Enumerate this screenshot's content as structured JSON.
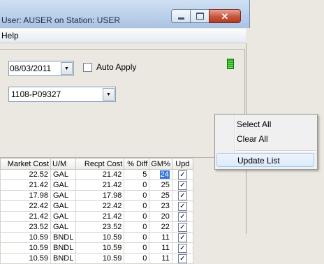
{
  "window": {
    "title": "User: AUSER on Station: USER",
    "close_glyph": "✕"
  },
  "menubar": {
    "items": [
      "Help"
    ]
  },
  "form": {
    "date_value": "08/03/2011",
    "auto_apply_label": "Auto Apply",
    "auto_apply_checked": false,
    "po_value": "1108-P09327",
    "status_color": "#2db31f"
  },
  "grid": {
    "columns": [
      "Market Cost",
      "U/M",
      "Recpt Cost",
      "% Diff",
      "GM%",
      "Upd"
    ],
    "rows": [
      {
        "market_cost": "22.52",
        "um": "GAL",
        "recpt_cost": "21.42",
        "pct_diff": "5",
        "gm": "24",
        "upd": "✓"
      },
      {
        "market_cost": "21.42",
        "um": "GAL",
        "recpt_cost": "21.42",
        "pct_diff": "0",
        "gm": "25",
        "upd": "✓"
      },
      {
        "market_cost": "17.98",
        "um": "GAL",
        "recpt_cost": "17.98",
        "pct_diff": "0",
        "gm": "25",
        "upd": "✓"
      },
      {
        "market_cost": "22.42",
        "um": "GAL",
        "recpt_cost": "22.42",
        "pct_diff": "0",
        "gm": "23",
        "upd": "✓"
      },
      {
        "market_cost": "21.42",
        "um": "GAL",
        "recpt_cost": "21.42",
        "pct_diff": "0",
        "gm": "20",
        "upd": "✓"
      },
      {
        "market_cost": "23.52",
        "um": "GAL",
        "recpt_cost": "23.52",
        "pct_diff": "0",
        "gm": "22",
        "upd": "✓"
      },
      {
        "market_cost": "10.59",
        "um": "BNDL",
        "recpt_cost": "10.59",
        "pct_diff": "0",
        "gm": "11",
        "upd": "✓"
      },
      {
        "market_cost": "10.59",
        "um": "BNDL",
        "recpt_cost": "10.59",
        "pct_diff": "0",
        "gm": "11",
        "upd": "✓"
      },
      {
        "market_cost": "10.59",
        "um": "BNDL",
        "recpt_cost": "10.59",
        "pct_diff": "0",
        "gm": "11",
        "upd": "✓"
      }
    ]
  },
  "context_menu": {
    "items": [
      "Select All",
      "Clear All",
      "Update List"
    ],
    "highlighted": "Update List"
  }
}
